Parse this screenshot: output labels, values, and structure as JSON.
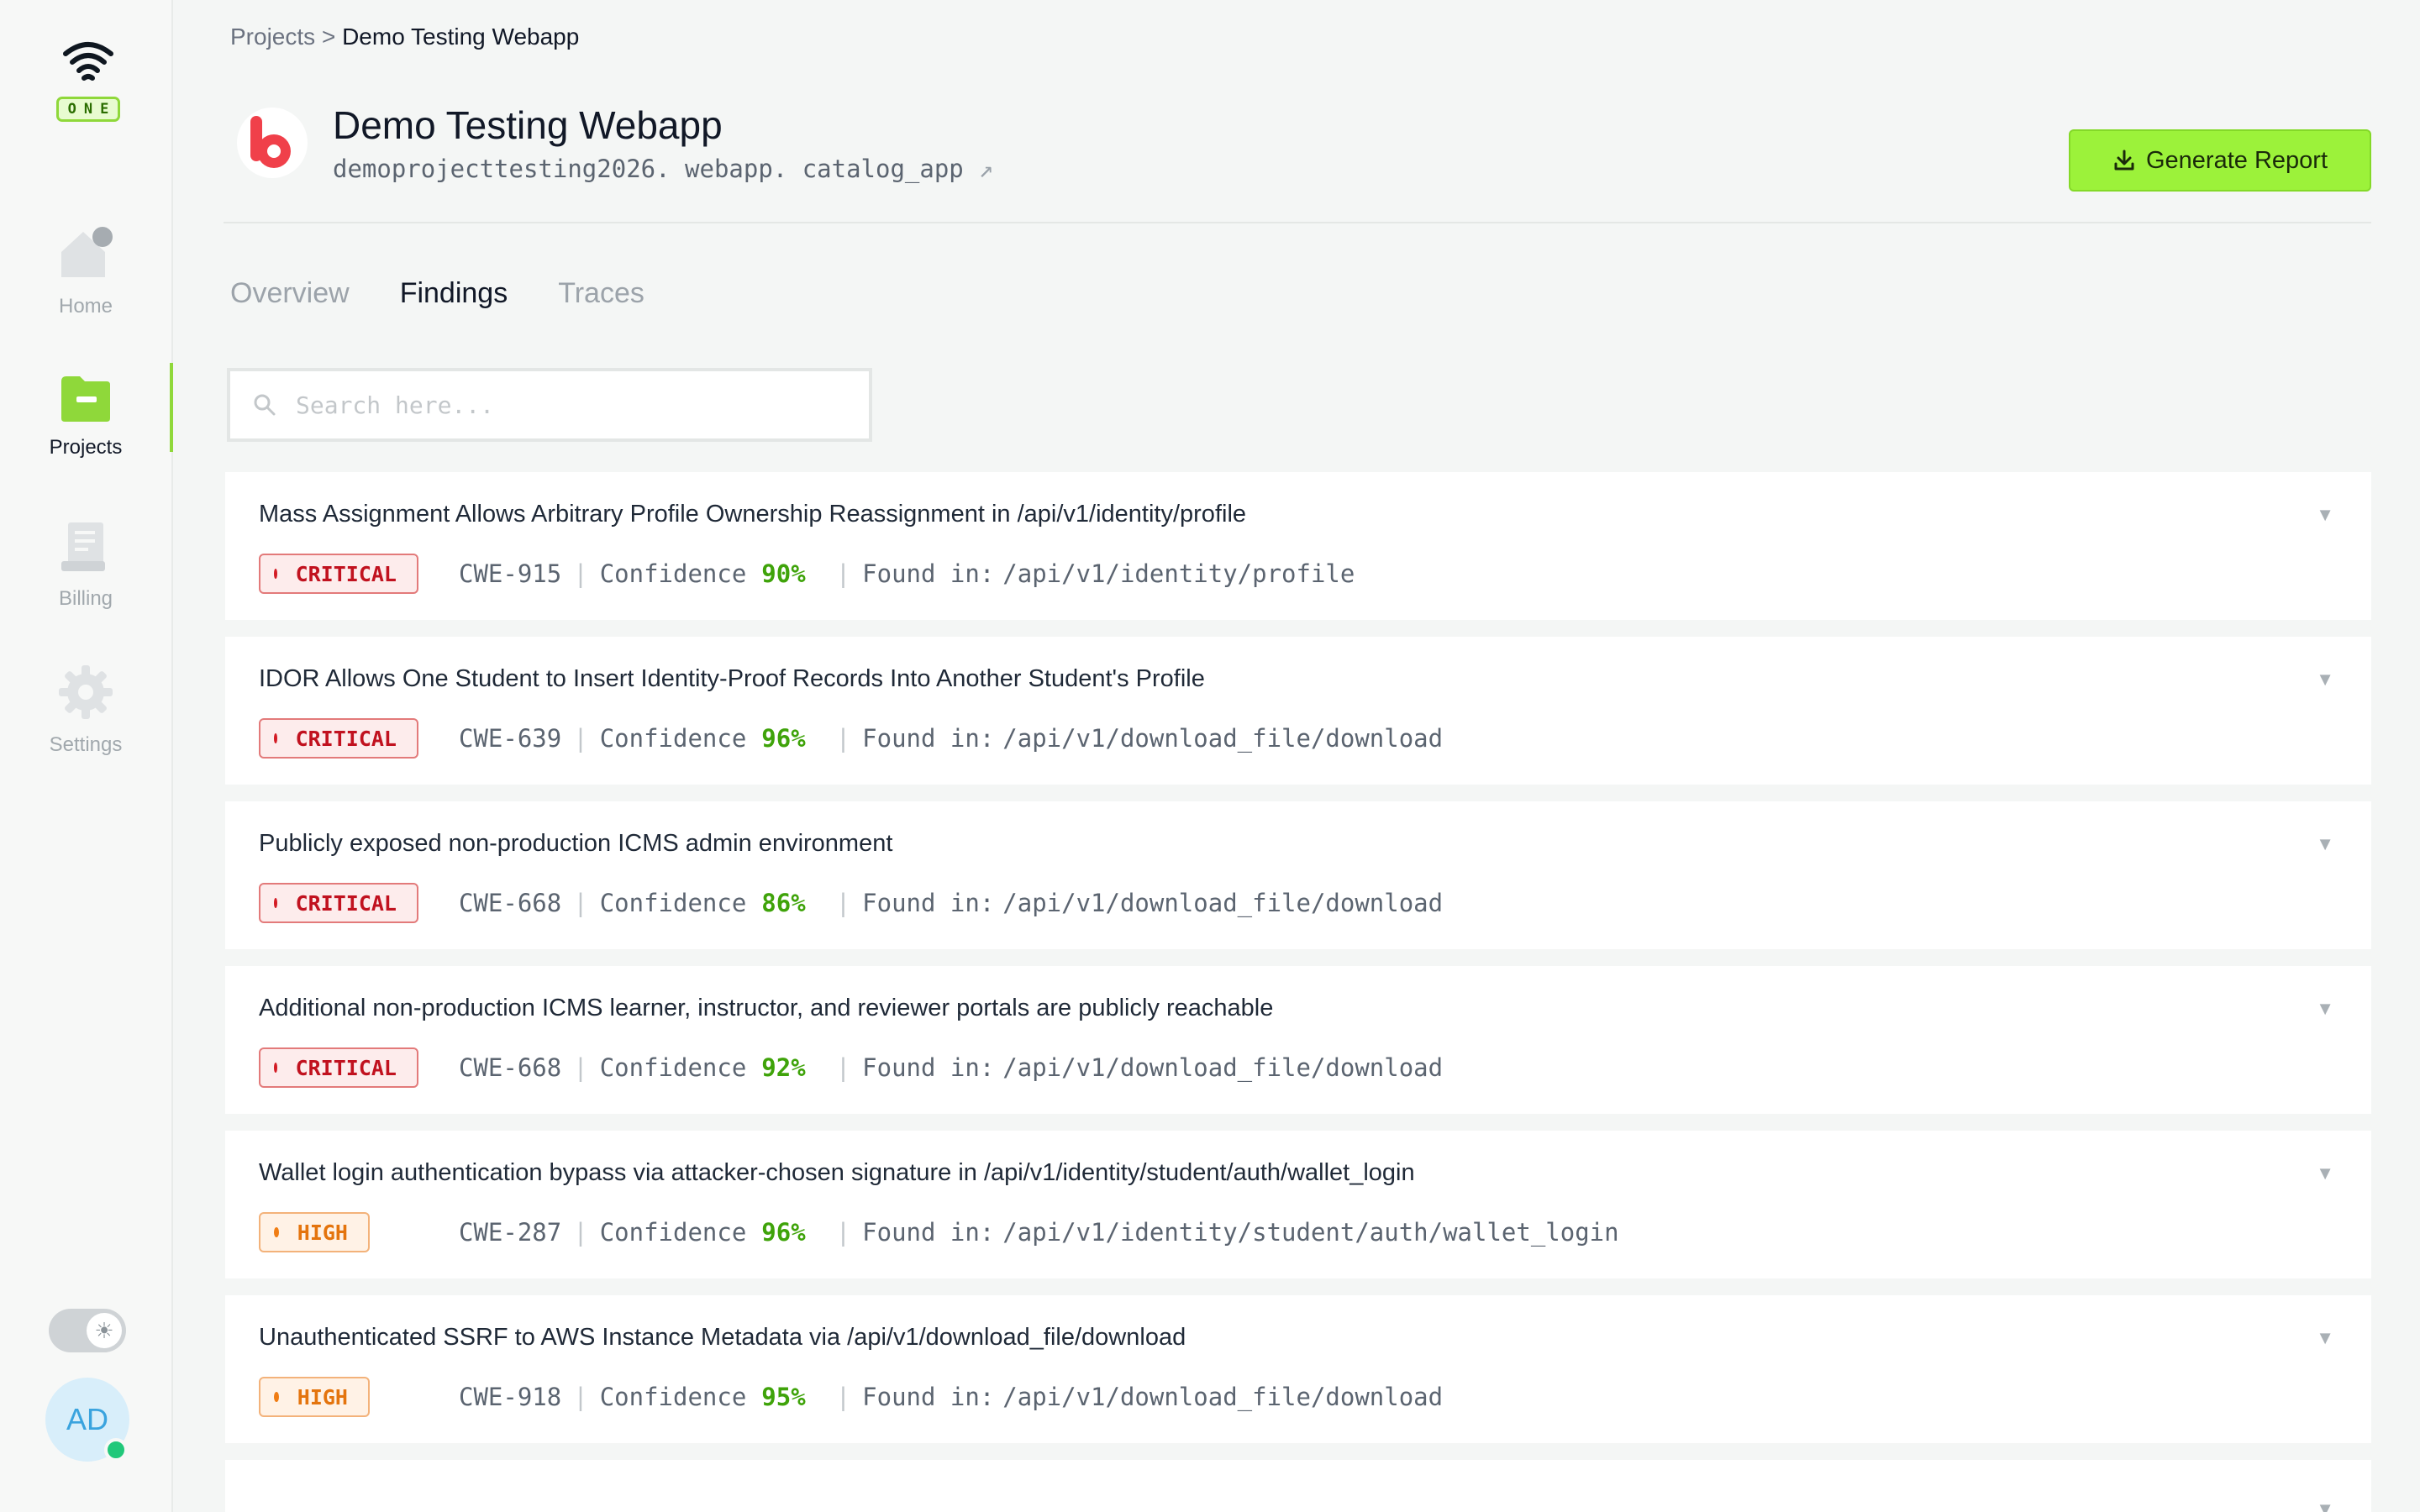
{
  "brand": {
    "badge": "ONE"
  },
  "nav": {
    "home": "Home",
    "projects": "Projects",
    "billing": "Billing",
    "settings": "Settings"
  },
  "user": {
    "initials": "AD"
  },
  "breadcrumb": {
    "root": "Projects",
    "separator": ">",
    "current": "Demo Testing Webapp"
  },
  "project": {
    "title": "Demo Testing Webapp",
    "subtitle": "demoprojecttesting2026. webapp. catalog_app"
  },
  "actions": {
    "generate_report": "Generate Report"
  },
  "tabs": [
    {
      "label": "Overview",
      "active": false
    },
    {
      "label": "Findings",
      "active": true
    },
    {
      "label": "Traces",
      "active": false
    }
  ],
  "search": {
    "placeholder": "Search here...",
    "value": ""
  },
  "findings": [
    {
      "title": "Mass Assignment Allows Arbitrary Profile Ownership Reassignment in /api/v1/identity/profile",
      "severity": "CRITICAL",
      "cwe": "CWE-915",
      "confidence_label": "Confidence",
      "confidence": "90%",
      "found_label": "Found in:",
      "location": "/api/v1/identity/profile"
    },
    {
      "title": "IDOR Allows One Student to Insert Identity-Proof Records Into Another Student's Profile",
      "severity": "CRITICAL",
      "cwe": "CWE-639",
      "confidence_label": "Confidence",
      "confidence": "96%",
      "found_label": "Found in:",
      "location": "/api/v1/download_file/download"
    },
    {
      "title": "Publicly exposed non-production ICMS admin environment",
      "severity": "CRITICAL",
      "cwe": "CWE-668",
      "confidence_label": "Confidence",
      "confidence": "86%",
      "found_label": "Found in:",
      "location": "/api/v1/download_file/download"
    },
    {
      "title": "Additional non-production ICMS learner, instructor, and reviewer portals are publicly reachable",
      "severity": "CRITICAL",
      "cwe": "CWE-668",
      "confidence_label": "Confidence",
      "confidence": "92%",
      "found_label": "Found in:",
      "location": "/api/v1/download_file/download"
    },
    {
      "title": "Wallet login authentication bypass via attacker-chosen signature in /api/v1/identity/student/auth/wallet_login",
      "severity": "HIGH",
      "cwe": "CWE-287",
      "confidence_label": "Confidence",
      "confidence": "96%",
      "found_label": "Found in:",
      "location": "/api/v1/identity/student/auth/wallet_login"
    },
    {
      "title": "Unauthenticated SSRF to AWS Instance Metadata via /api/v1/download_file/download",
      "severity": "HIGH",
      "cwe": "CWE-918",
      "confidence_label": "Confidence",
      "confidence": "95%",
      "found_label": "Found in:",
      "location": "/api/v1/download_file/download"
    }
  ],
  "colors": {
    "accent": "#9cf23a",
    "critical": "#c1121f",
    "high": "#e4740d",
    "confidence": "#3fa30a"
  },
  "icons": {
    "brand": "wifi-icon",
    "home": "home-icon",
    "projects": "folder-icon",
    "billing": "receipt-icon",
    "settings": "gear-icon",
    "report": "download-icon",
    "external": "external-link-icon",
    "search": "search-icon",
    "expand": "chevron-down-icon",
    "theme": "sun-icon"
  }
}
